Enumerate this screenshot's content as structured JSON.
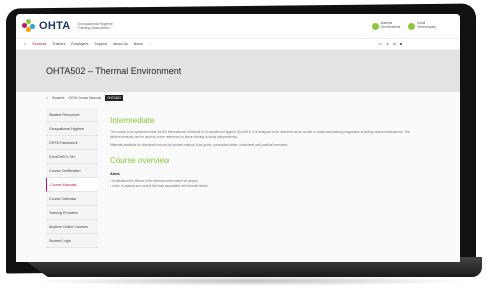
{
  "header": {
    "logo_text": "OHTA",
    "logo_sub": "Occupational Hygiene Training Association",
    "contacts": [
      {
        "line1": "Address",
        "line2": "Get directions"
      },
      {
        "line1": "Email",
        "line2": "Send enquiry"
      }
    ],
    "colors": {
      "brand_blue": "#1e3a63",
      "accent_green": "#8cc63f",
      "accent_pink": "#c2185b"
    }
  },
  "nav": {
    "home_icon": "home-icon",
    "items": [
      "Students",
      "Trainers",
      "Employers",
      "Support",
      "About Us",
      "News"
    ],
    "active_index": 0,
    "right_icons": [
      "cart-icon",
      "x-icon",
      "linkedin-icon",
      "menu-icon"
    ]
  },
  "page": {
    "title": "OHTA502 – Thermal Environment",
    "breadcrumb": [
      "Students",
      "OHTA Course Manuals",
      "OHTA502"
    ]
  },
  "sidebar": {
    "items": [
      "Student Resources",
      "Occupational Hygiene",
      "OHTA Framework",
      "ICertOH/ICx OH",
      "Course Certification",
      "Course Manuals",
      "Course Calendar",
      "Training Providers",
      "Anytime Online Courses",
      "Student Login"
    ],
    "active_index": 5
  },
  "main": {
    "intermediate_heading": "Intermediate",
    "para1": "The course is an optional module for the International Certificate in Occupational Hygiene (ICertOH). It is designed to be delivered as an on-line or classroom training programme including student assessment. The student manuals can be used as a free reference for those wishing to study independently.",
    "para2": "Materials available for download include the student manual, tutor guide, powerpoint slides, worksheet and practical exercises.",
    "overview_heading": "Course overview",
    "aims_heading": "Aims",
    "aims": [
      "Understand the effects of the thermal environment on people.",
      "Learn to assess and control the risks associated with thermal stress."
    ]
  }
}
